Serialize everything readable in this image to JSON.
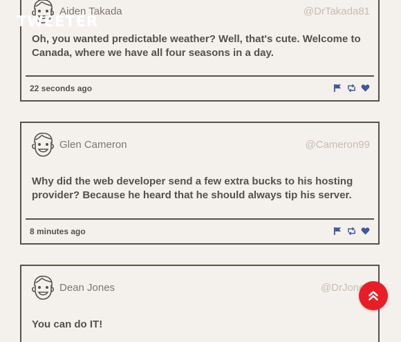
{
  "brand": {
    "title": "TWEETER"
  },
  "tweets": [
    {
      "author": "Aiden Takada",
      "handle": "@DrTakada81",
      "text": "Oh, you wanted predictable weather? Well, that's cute. Welcome to Canada, where we have all four seasons in a day.",
      "timestamp": "22 seconds ago",
      "avatar_icon": "cartoon-face-icon"
    },
    {
      "author": "Glen Cameron",
      "handle": "@Cameron99",
      "text": "Why did the web developer send a few extra bucks to his hosting provider? Because he heard that he should always tip his server.",
      "timestamp": "8 minutes ago",
      "avatar_icon": "cartoon-face-icon"
    },
    {
      "author": "Dean Jones",
      "handle": "@DrJones",
      "text": "You can do IT!",
      "timestamp": "",
      "avatar_icon": "cartoon-face-icon"
    }
  ],
  "actions": {
    "icons": [
      "flag-icon",
      "retweet-icon",
      "heart-icon"
    ],
    "color": "#4056a1"
  },
  "scroll_top": {
    "icon": "double-chevron-up-icon",
    "color": "#ea1d26"
  },
  "colors": {
    "background": "#f4f1ec",
    "text": "#545149",
    "border": "#545149",
    "handle": "#c4beb4"
  }
}
